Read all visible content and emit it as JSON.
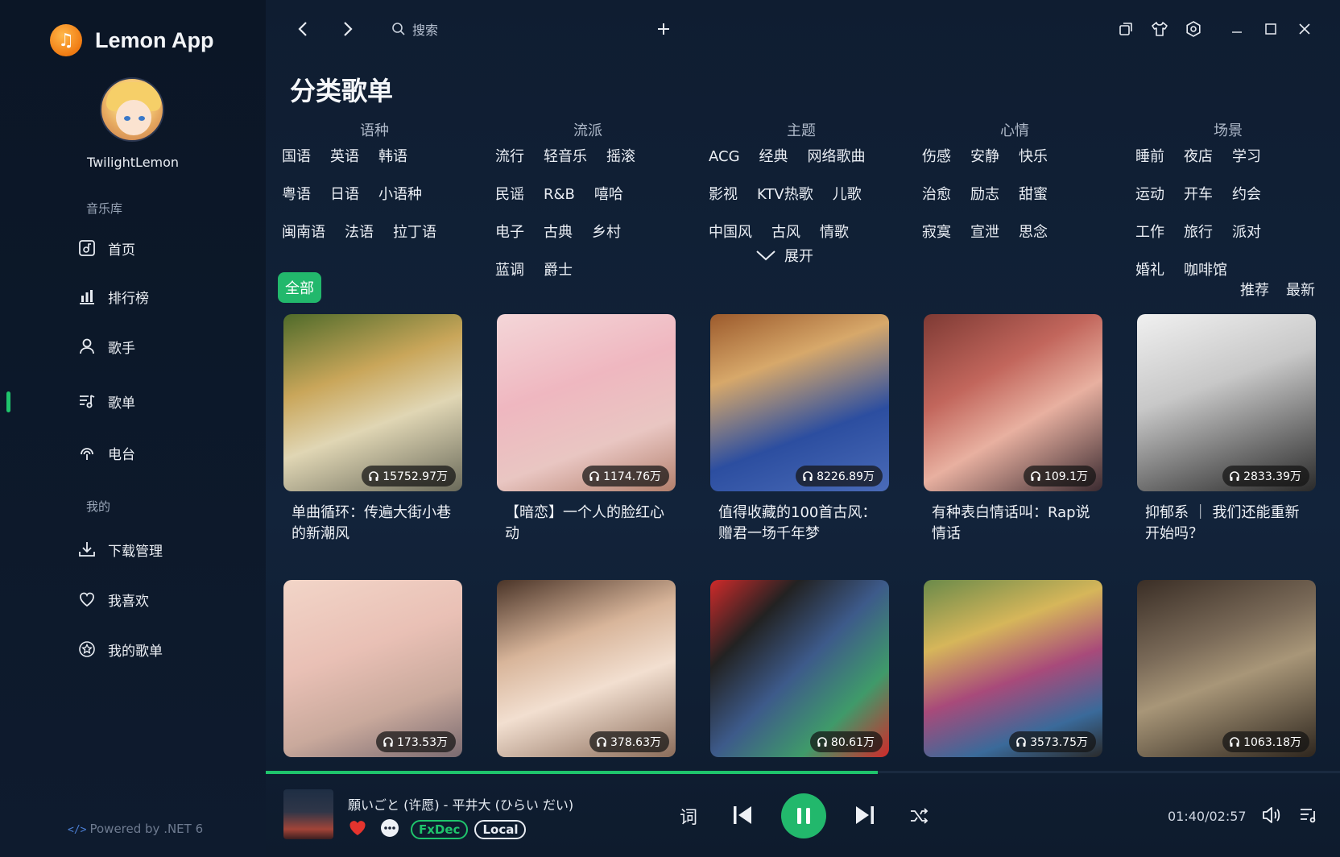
{
  "app": {
    "name": "Lemon App",
    "logo_glyph": "♫",
    "accent": "#1fc46c"
  },
  "user": {
    "name": "TwilightLemon"
  },
  "sidebar": {
    "library_label": "音乐库",
    "mine_label": "我的",
    "items": [
      {
        "label": "首页",
        "icon": "home-icon"
      },
      {
        "label": "排行榜",
        "icon": "chart-icon"
      },
      {
        "label": "歌手",
        "icon": "person-icon"
      },
      {
        "label": "歌单",
        "icon": "playlist-icon",
        "active": true
      },
      {
        "label": "电台",
        "icon": "radio-icon"
      },
      {
        "label": "下载管理",
        "icon": "download-icon"
      },
      {
        "label": "我喜欢",
        "icon": "heart-icon"
      },
      {
        "label": "我的歌单",
        "icon": "star-icon"
      }
    ],
    "powered_code": "</>",
    "powered_text": "Powered by .NET 6"
  },
  "topbar": {
    "search_label": "搜索"
  },
  "page": {
    "title": "分类歌单"
  },
  "categories": [
    {
      "head": "语种",
      "tags": [
        "国语",
        "英语",
        "韩语",
        "粤语",
        "日语",
        "小语种",
        "闽南语",
        "法语",
        "拉丁语"
      ]
    },
    {
      "head": "流派",
      "tags": [
        "流行",
        "轻音乐",
        "摇滚",
        "民谣",
        "R&B",
        "嘻哈",
        "电子",
        "古典",
        "乡村",
        "蓝调",
        "爵士"
      ]
    },
    {
      "head": "主题",
      "tags": [
        "ACG",
        "经典",
        "网络歌曲",
        "影视",
        "KTV热歌",
        "儿歌",
        "中国风",
        "古风",
        "情歌"
      ]
    },
    {
      "head": "心情",
      "tags": [
        "伤感",
        "安静",
        "快乐",
        "治愈",
        "励志",
        "甜蜜",
        "寂寞",
        "宣泄",
        "思念"
      ]
    },
    {
      "head": "场景",
      "tags": [
        "睡前",
        "夜店",
        "学习",
        "运动",
        "开车",
        "约会",
        "工作",
        "旅行",
        "派对",
        "婚礼",
        "咖啡馆"
      ]
    }
  ],
  "expand_label": "展开",
  "filter": {
    "all_label": "全部",
    "sort_recommend": "推荐",
    "sort_latest": "最新"
  },
  "playlists": [
    {
      "title": "单曲循环：传遍大街小巷的新潮风",
      "plays": "15752.97万"
    },
    {
      "title": "【暗恋】一个人的脸红心动",
      "plays": "1174.76万"
    },
    {
      "title": "值得收藏的100首古风： 赠君一场千年梦",
      "plays": "8226.89万"
    },
    {
      "title": "有种表白情话叫：Rap说情话",
      "plays": "109.1万"
    },
    {
      "title": "抑郁系 ｜ 我们还能重新开始吗？",
      "plays": "2833.39万"
    },
    {
      "title": "",
      "plays": "173.53万"
    },
    {
      "title": "",
      "plays": "378.63万"
    },
    {
      "title": "",
      "plays": "80.61万"
    },
    {
      "title": "",
      "plays": "3573.75万"
    },
    {
      "title": "",
      "plays": "1063.18万"
    }
  ],
  "player": {
    "track": "願いごと (许愿) - 平井大 (ひらい だい)",
    "tags": [
      "FxDec",
      "Local"
    ],
    "lyrics_label": "词",
    "time": "01:40/02:57",
    "progress": 0.57
  }
}
